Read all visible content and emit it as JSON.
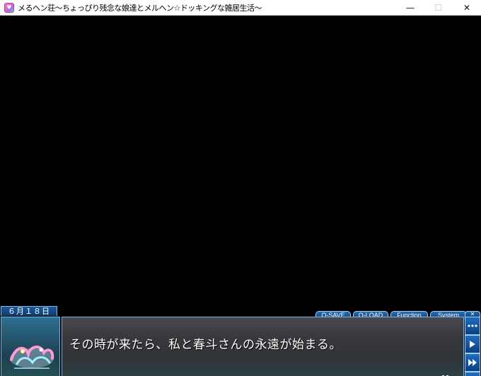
{
  "window": {
    "title": "メるヘン荘～ちょっぴり残念な娘達とメルヘン☆ドッキングな雑居生活～",
    "minimize_glyph": "—",
    "maximize_glyph": "☐",
    "close_glyph": "✕"
  },
  "hud": {
    "date": "６月１８日",
    "menu": [
      {
        "label": "Q-SAVE"
      },
      {
        "label": "Q-LOAD"
      },
      {
        "label": "Function"
      },
      {
        "label": "System"
      }
    ],
    "close_label": "✕"
  },
  "message": {
    "text": "その時が来たら、私と春斗さんの永遠が始まる。"
  },
  "colors": {
    "accent": "#6fb6e8",
    "button": "#1e6ec0",
    "message_bg": "#3a3a3e"
  }
}
